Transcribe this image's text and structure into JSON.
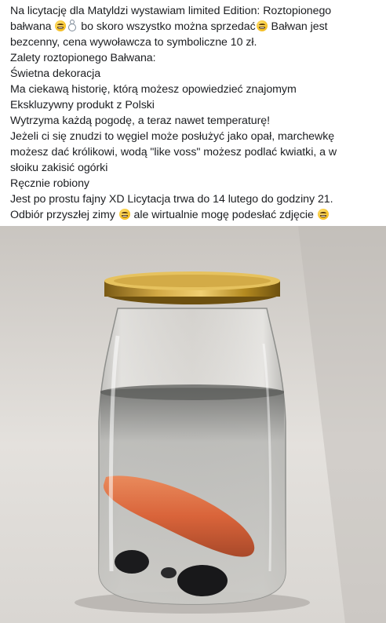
{
  "post": {
    "lines": [
      {
        "parts": [
          "Na licytację dla Matyldzi wystawiam limited Edition: Roztopionego"
        ]
      },
      {
        "parts": [
          "bałwana ",
          "",
          " bo skoro wszystko można sprzedać",
          " Bałwan jest"
        ]
      },
      {
        "parts": [
          "bezcenny, cena wywoławcza to symboliczne 10 zł."
        ]
      },
      {
        "parts": [
          "Zalety roztopionego Bałwana:"
        ]
      },
      {
        "parts": [
          "Świetna dekoracja"
        ]
      },
      {
        "parts": [
          "Ma ciekawą historię, którą możesz opowiedzieć znajomym"
        ]
      },
      {
        "parts": [
          "Ekskluzywny produkt z Polski"
        ]
      },
      {
        "parts": [
          "Wytrzyma każdą pogodę, a teraz nawet temperaturę!"
        ]
      },
      {
        "parts": [
          "Jeżeli ci się znudzi to węgiel może posłużyć jako opał, marchewkę"
        ]
      },
      {
        "parts": [
          "możesz dać królikowi, wodą \"like voss\" możesz podlać kwiatki, a w"
        ]
      },
      {
        "parts": [
          "słoiku zakisić ogórki"
        ]
      },
      {
        "parts": [
          "Ręcznie robiony"
        ]
      },
      {
        "parts": [
          "Jest po prostu fajny XD Licytacja trwa do 14 lutego do godziny 21."
        ]
      },
      {
        "parts": [
          "Odbiór przyszłej zimy ",
          " ale wirtualnie mogę podesłać zdjęcie "
        ]
      }
    ]
  },
  "icons": {
    "grin": "grinning-face-emoji",
    "snowman": "snowman-emoji"
  },
  "colors": {
    "text": "#1c1e21",
    "background": "#ffffff",
    "lid": "#b58a2a",
    "carrot": "#d9643a"
  }
}
